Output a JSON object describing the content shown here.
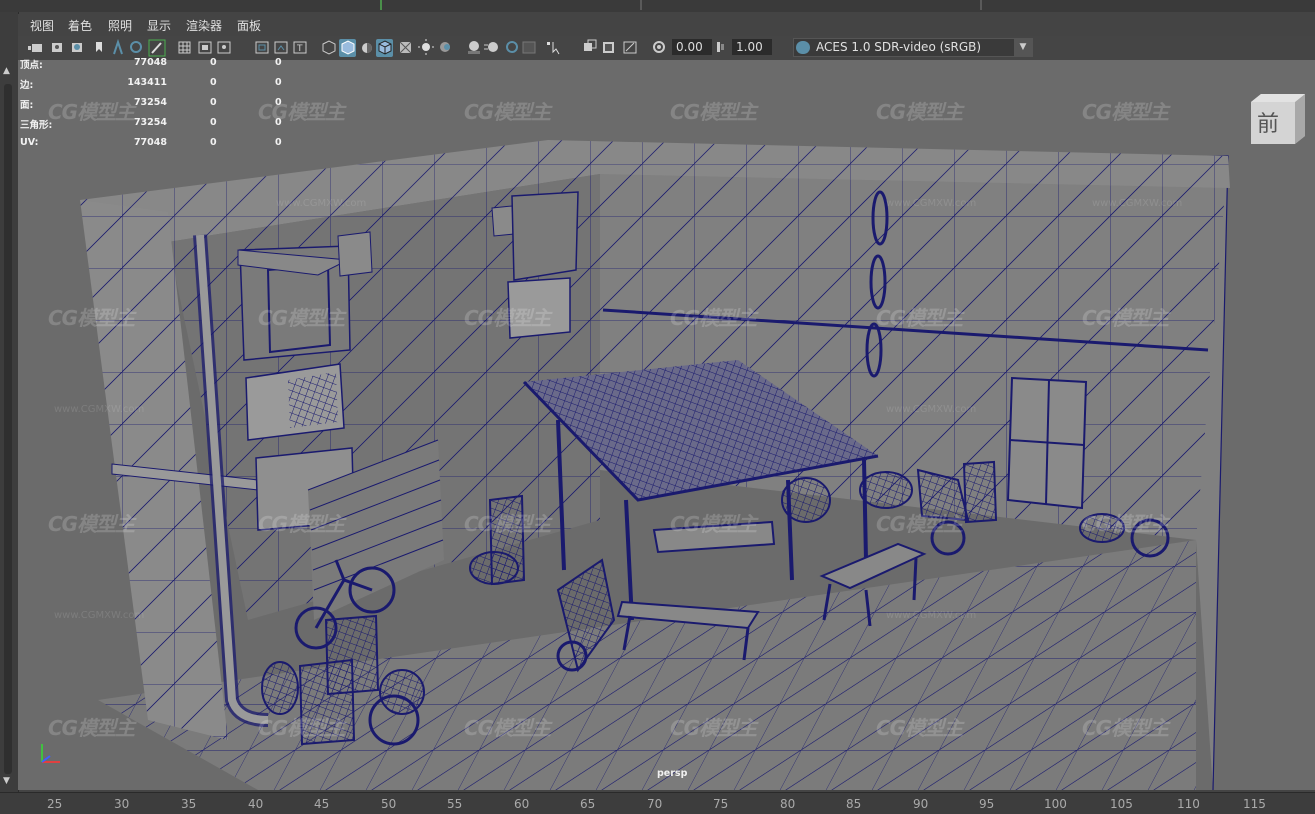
{
  "menu": {
    "items": [
      "视图",
      "着色",
      "照明",
      "显示",
      "渲染器",
      "面板"
    ]
  },
  "toolbar": {
    "exposure": "0.00",
    "gamma": "1.00",
    "color_space": "ACES 1.0 SDR-video (sRGB)",
    "icons": [
      "camera-select-icon",
      "camera-attributes-icon",
      "bookmark-icon",
      "image-plane-icon",
      "grid-icon",
      "film-gate-icon",
      "resolution-gate-icon",
      "gate-mask-icon",
      "field-chart-icon",
      "safe-action-icon",
      "safe-title-icon",
      "wireframe-icon",
      "smooth-shade-icon",
      "default-material-icon",
      "wireframe-on-shaded-icon",
      "xray-icon",
      "textured-icon",
      "use-lights-icon",
      "shadows-icon",
      "screen-space-ao-icon",
      "motion-blur-icon",
      "anti-aliasing-icon",
      "depth-of-field-icon",
      "isolate-select-icon",
      "xray-joints-icon",
      "xray-components-icon",
      "hud-icon",
      "exposure-icon",
      "gamma-icon",
      "color-management-icon"
    ]
  },
  "hud": {
    "rows": [
      {
        "label": "顶点:",
        "v1": "77048",
        "v2": "0",
        "v3": "0"
      },
      {
        "label": "边:",
        "v1": "143411",
        "v2": "0",
        "v3": "0"
      },
      {
        "label": "面:",
        "v1": "73254",
        "v2": "0",
        "v3": "0"
      },
      {
        "label": "三角形:",
        "v1": "73254",
        "v2": "0",
        "v3": "0"
      },
      {
        "label": "UV:",
        "v1": "77048",
        "v2": "0",
        "v3": "0"
      }
    ]
  },
  "viewcube": {
    "face": "前"
  },
  "viewport": {
    "camera": "persp"
  },
  "watermark": {
    "logo": "CG模型主",
    "url": "www.CGMXW.com"
  },
  "timeline": {
    "ticks": [
      "25",
      "30",
      "35",
      "40",
      "45",
      "50",
      "55",
      "60",
      "65",
      "70",
      "75",
      "80",
      "85",
      "90",
      "95",
      "100",
      "105",
      "110",
      "115"
    ]
  },
  "colors": {
    "wire": "#1a1a6e",
    "mesh_fill": "#7b7b7b",
    "background": "#6b6b6b",
    "accent": "#5b8fa8"
  }
}
